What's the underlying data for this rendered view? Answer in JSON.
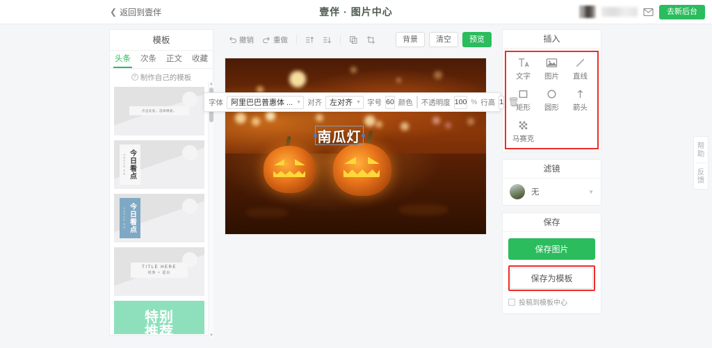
{
  "header": {
    "back_label": "返回到壹伴",
    "back_icon": "chevron-left-icon",
    "title": "壹伴 · 图片中心",
    "mail_icon": "mail-icon",
    "cta_label": "去新后台"
  },
  "template_panel": {
    "title": "模板",
    "tabs": [
      {
        "label": "头条",
        "active": true
      },
      {
        "label": "次条",
        "active": false
      },
      {
        "label": "正文",
        "active": false
      },
      {
        "label": "收藏",
        "active": false
      }
    ],
    "make_own": {
      "icon": "question-circle-icon",
      "label": "制作自己的模板"
    },
    "cards": [
      {
        "type": "banner",
        "caption": "点击此处，选择模板。"
      },
      {
        "type": "vertical",
        "eng": "FOCUS ON",
        "cn": "今日看点",
        "style": "light"
      },
      {
        "type": "vertical",
        "eng": "FOCUS ON",
        "cn": "今日看点",
        "style": "blue"
      },
      {
        "type": "title-here",
        "title": "TITLE HERE",
        "subtitle": "线条 × 留白"
      },
      {
        "type": "green",
        "text_line1": "特别",
        "text_line2": "推荐"
      }
    ]
  },
  "canvas_toolbar": {
    "items": [
      {
        "icon": "undo-icon",
        "label": "撤销"
      },
      {
        "icon": "redo-icon",
        "label": "重做"
      },
      {
        "icon": "layer-up-icon",
        "label": ""
      },
      {
        "icon": "layer-down-icon",
        "label": ""
      },
      {
        "icon": "copy-icon",
        "label": ""
      },
      {
        "icon": "crop-icon",
        "label": ""
      }
    ],
    "background_label": "背景",
    "clear_label": "清空",
    "preview_label": "预览"
  },
  "canvas": {
    "text_object": "南瓜灯",
    "image_description": "two jack-o-lantern pumpkins on autumn leaves with bokeh lights"
  },
  "text_props": {
    "font_label": "字体",
    "font_value": "阿里巴巴普惠体 ...",
    "align_label": "对齐",
    "align_value": "左对齐",
    "size_label": "字号",
    "size_value": "60",
    "color_label": "颜色",
    "color_value": "#ffffff",
    "opacity_label": "不透明度",
    "opacity_value": "100",
    "opacity_unit": "%",
    "lineheight_label": "行高",
    "lineheight_value": "1",
    "delete_icon": "trash-icon"
  },
  "insert_panel": {
    "title": "插入",
    "highlight_color": "#ee2a26",
    "items": [
      {
        "icon": "text-icon",
        "label": "文字"
      },
      {
        "icon": "image-icon",
        "label": "图片"
      },
      {
        "icon": "line-icon",
        "label": "直线"
      },
      {
        "icon": "rectangle-icon",
        "label": "矩形"
      },
      {
        "icon": "circle-icon",
        "label": "圆形"
      },
      {
        "icon": "arrow-up-icon",
        "label": "箭头"
      },
      {
        "icon": "mosaic-icon",
        "label": "马赛克"
      }
    ]
  },
  "filter_panel": {
    "title": "滤镜",
    "selected": "无",
    "caret_icon": "chevron-down-icon"
  },
  "save_panel": {
    "title": "保存",
    "save_image_label": "保存图片",
    "save_template_label": "保存为模板",
    "highlight_color": "#ee2a26",
    "submit_checkbox_label": "投稿到模板中心",
    "submit_checked": false
  },
  "side_tabs": [
    {
      "label": "帮助"
    },
    {
      "label": "反馈"
    }
  ],
  "colors": {
    "accent_green": "#2bbc5d",
    "highlight_red": "#ee2a26"
  }
}
